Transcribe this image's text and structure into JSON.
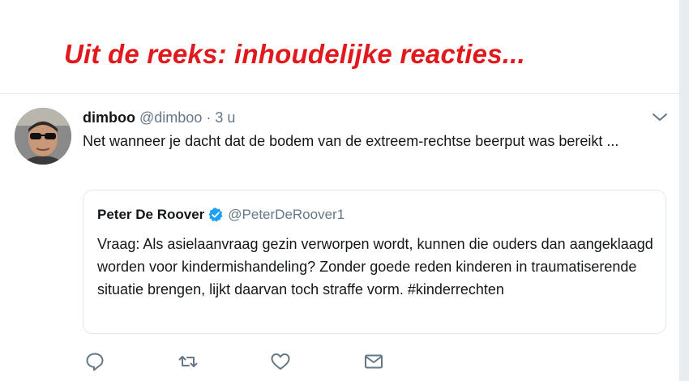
{
  "headline": "Uit de reeks: inhoudelijke reacties...",
  "tweet": {
    "author_name": "dimboo",
    "author_handle": "@dimboo",
    "separator": "·",
    "time": "3 u",
    "text": "Net wanneer je dacht dat de bodem van de extreem-rechtse beerput was bereikt ..."
  },
  "quoted_tweet": {
    "author_name": "Peter De Roover",
    "author_handle": "@PeterDeRoover1",
    "text": "Vraag: Als asielaanvraag gezin verworpen wordt, kunnen die ouders dan aangeklaagd worden voor kindermishandeling? Zonder goede reden kinderen in traumatiserende situatie brengen, lijkt daarvan toch straffe vorm. #kinderrechten"
  },
  "icons": {
    "menu": "chevron-down-icon",
    "verified": "verified-badge-icon",
    "reply": "reply-icon",
    "retweet": "retweet-icon",
    "like": "heart-icon",
    "message": "envelope-icon"
  },
  "colors": {
    "headline": "#e0191d",
    "text": "#14171a",
    "secondary": "#657786",
    "verified": "#1da1f2",
    "border": "#e1e8ed"
  }
}
